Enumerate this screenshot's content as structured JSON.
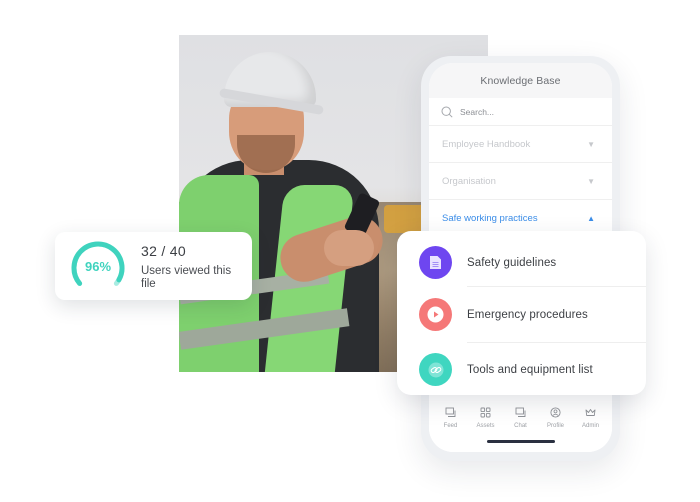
{
  "photo": {
    "subject": "construction worker in hard hat and high-visibility vest using a smartphone"
  },
  "phone": {
    "header_title": "Knowledge Base",
    "search": {
      "placeholder": "Search...",
      "icon": "search-icon"
    },
    "categories": [
      {
        "label": "Employee Handbook",
        "state": "collapsed",
        "icon": "triangle-down-icon",
        "glyph": "▼"
      },
      {
        "label": "Organisation",
        "state": "collapsed",
        "icon": "triangle-down-icon",
        "glyph": "▼"
      },
      {
        "label": "Safe working practices",
        "state": "expanded",
        "icon": "triangle-up-icon",
        "glyph": "▲"
      }
    ],
    "tabbar": [
      {
        "label": "Feed",
        "icon": "feed-icon"
      },
      {
        "label": "Assets",
        "icon": "grid-icon"
      },
      {
        "label": "Chat",
        "icon": "chat-icon"
      },
      {
        "label": "Profile",
        "icon": "profile-icon"
      },
      {
        "label": "Admin",
        "icon": "crown-icon"
      }
    ]
  },
  "content_card": {
    "items": [
      {
        "label": "Safety guidelines",
        "icon": "document-icon",
        "color": "#6e46f0"
      },
      {
        "label": "Emergency procedures",
        "icon": "play-icon",
        "color": "#f57878"
      },
      {
        "label": "Tools and equipment list",
        "icon": "link-icon",
        "color": "#3fd6c0"
      }
    ]
  },
  "stats_card": {
    "percent_label": "96%",
    "percent_value": 96,
    "count": "32 / 40",
    "label": "Users viewed this file",
    "accent_color": "#3fd3be"
  },
  "colors": {
    "active_blue": "#3b8de8",
    "muted_text": "#c6c8cc"
  }
}
